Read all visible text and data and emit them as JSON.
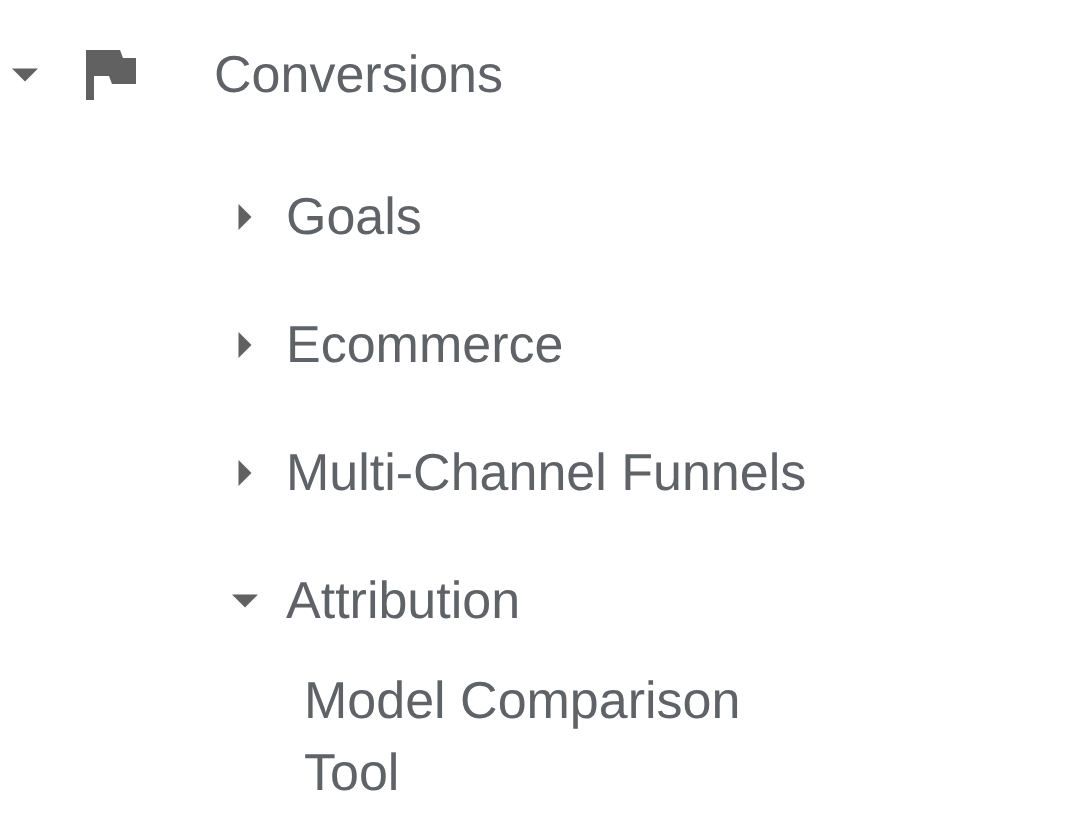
{
  "tree": [
    {
      "label": "Conversions",
      "expanded": true,
      "children": [
        {
          "label": "Goals",
          "expanded": false
        },
        {
          "label": "Ecommerce",
          "expanded": false
        },
        {
          "label": "Multi-Channel Funnels",
          "expanded": false
        },
        {
          "label": "Attribution",
          "expanded": true,
          "children": [
            {
              "label": "Model Comparison Tool"
            }
          ]
        }
      ]
    }
  ]
}
